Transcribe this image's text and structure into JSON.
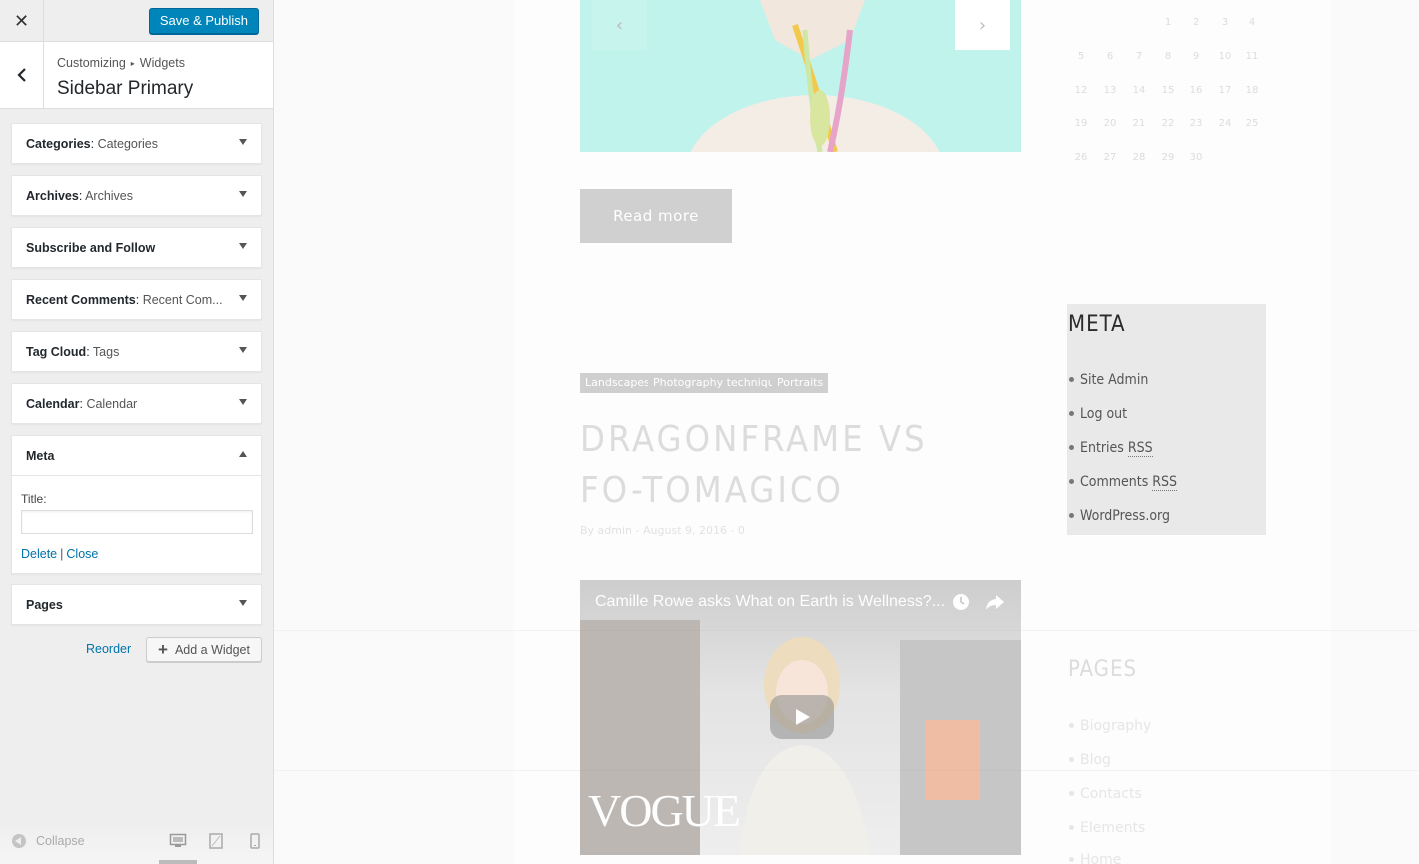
{
  "header": {
    "publish_label": "Save & Publish"
  },
  "section": {
    "breadcrumb_root": "Customizing",
    "breadcrumb_current": "Widgets",
    "title": "Sidebar Primary"
  },
  "widgets": [
    {
      "name": "Categories",
      "sub": "Categories",
      "expanded": false
    },
    {
      "name": "Archives",
      "sub": "Archives",
      "expanded": false
    },
    {
      "name": "Subscribe and Follow",
      "sub": "",
      "expanded": false
    },
    {
      "name": "Recent Comments",
      "sub": "Recent Com...",
      "expanded": false
    },
    {
      "name": "Tag Cloud",
      "sub": "Tags",
      "expanded": false
    },
    {
      "name": "Calendar",
      "sub": "Calendar",
      "expanded": false
    },
    {
      "name": "Meta",
      "sub": "",
      "expanded": true,
      "title_label": "Title:",
      "title_value": "",
      "delete_label": "Delete",
      "close_label": "Close"
    },
    {
      "name": "Pages",
      "sub": "",
      "expanded": false
    }
  ],
  "actions": {
    "reorder_label": "Reorder",
    "add_widget_label": "Add a Widget"
  },
  "footer": {
    "collapse_label": "Collapse"
  },
  "preview": {
    "read_more": "Read more",
    "tags": [
      "Landscapes",
      "Photography techniques",
      "Portraits"
    ],
    "post_title": "DRAGONFRAME VS FO-TOMAGICO",
    "post_meta": "By admin - August 9, 2016 - 0",
    "video_title": "Camille Rowe asks What on Earth is Wellness?...",
    "video_brand": "VOGUE",
    "calendar_rows": [
      [
        "",
        "",
        "",
        "1",
        "2",
        "3",
        "4"
      ],
      [
        "5",
        "6",
        "7",
        "8",
        "9",
        "10",
        "11"
      ],
      [
        "12",
        "13",
        "14",
        "15",
        "16",
        "17",
        "18"
      ],
      [
        "19",
        "20",
        "21",
        "22",
        "23",
        "24",
        "25"
      ],
      [
        "26",
        "27",
        "28",
        "29",
        "30",
        "",
        ""
      ]
    ],
    "meta_heading": "META",
    "meta_items": [
      "Site Admin",
      "Log out",
      "Entries ",
      "Comments ",
      "WordPress.org"
    ],
    "rss_label": "RSS",
    "pages_heading": "PAGES",
    "pages_items": [
      "Biography",
      "Blog",
      "Contacts",
      "Elements",
      "Home"
    ]
  },
  "colors": {
    "accent": "#0085ba",
    "link": "#0073aa",
    "sidebar_bg": "#eeeeee",
    "hero_teal": "#bff3ec"
  }
}
